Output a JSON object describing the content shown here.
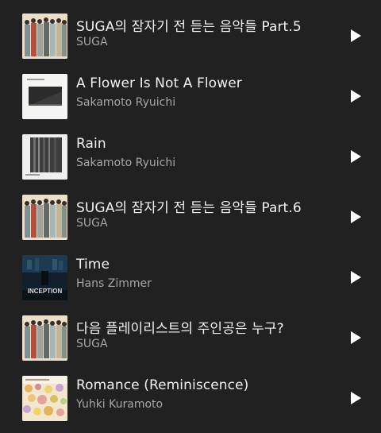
{
  "colors": {
    "background": "#212121",
    "title_text": "#f2f2f2",
    "artist_text": "#a6a6a6",
    "play_icon": "#ffffff"
  },
  "tracks": [
    {
      "title": "SUGA의 잠자기 전 듣는 음악들 Part.5",
      "artist": "SUGA",
      "icon": "play-icon"
    },
    {
      "title": "A Flower Is Not A Flower",
      "artist": "Sakamoto Ryuichi",
      "icon": "play-icon"
    },
    {
      "title": "Rain",
      "artist": "Sakamoto Ryuichi",
      "icon": "play-icon"
    },
    {
      "title": "SUGA의 잠자기 전 듣는 음악들 Part.6",
      "artist": "SUGA",
      "icon": "play-icon"
    },
    {
      "title": "Time",
      "artist": "Hans Zimmer",
      "icon": "play-icon"
    },
    {
      "title": "다음 플레이리스트의 주인공은 누구?",
      "artist": "SUGA",
      "icon": "play-icon"
    },
    {
      "title": "Romance (Reminiscence)",
      "artist": "Yuhki Kuramoto",
      "icon": "play-icon"
    }
  ],
  "inception_logo_text": "INCEPTION"
}
